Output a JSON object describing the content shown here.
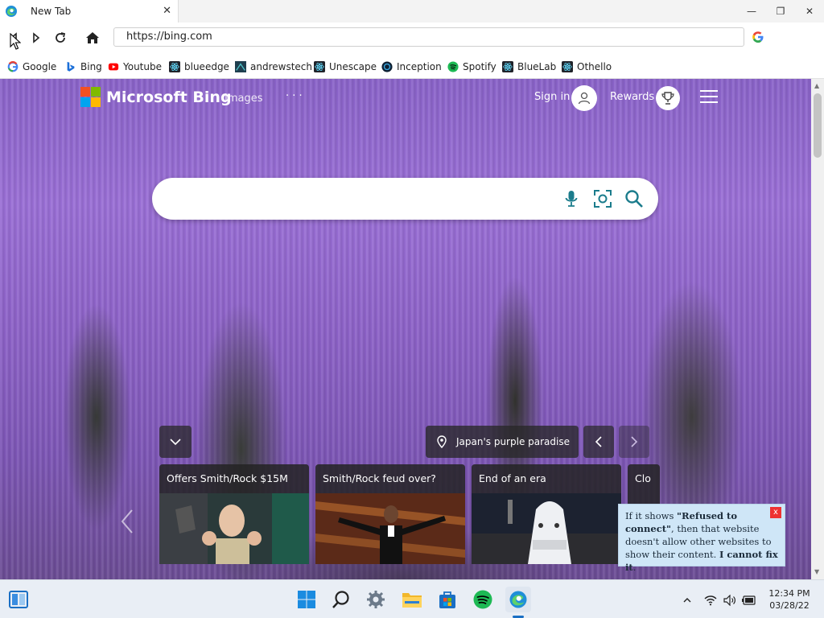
{
  "browser": {
    "tab_title": "New Tab",
    "tab_close": "✕",
    "address": "https://bing.com",
    "controls": {
      "minimize": "—",
      "maximize": "❐",
      "close": "✕"
    }
  },
  "bookmarks": [
    {
      "label": "Google",
      "icon": "google-icon"
    },
    {
      "label": "Bing",
      "icon": "bing-icon"
    },
    {
      "label": "Youtube",
      "icon": "youtube-icon"
    },
    {
      "label": "blueedge",
      "icon": "react-icon"
    },
    {
      "label": "andrewstech",
      "icon": "andrewstech-icon"
    },
    {
      "label": "Unescape",
      "icon": "react-icon"
    },
    {
      "label": "Inception",
      "icon": "inception-icon"
    },
    {
      "label": "Spotify",
      "icon": "spotify-icon"
    },
    {
      "label": "BlueLab",
      "icon": "react-icon"
    },
    {
      "label": "Othello",
      "icon": "react-icon"
    }
  ],
  "bing": {
    "brand": "Microsoft Bing",
    "images_link": "Images",
    "more": "· · ·",
    "sign_in": "Sign in",
    "rewards": "Rewards",
    "location_text": "Japan's purple paradise",
    "news": [
      {
        "title": "Offers Smith/Rock $15M"
      },
      {
        "title": "Smith/Rock feud over?"
      },
      {
        "title": "End of an era"
      },
      {
        "title": "Clo"
      }
    ]
  },
  "tooltip": {
    "line1": "If it shows ",
    "bold1": "\"Refused to connect\"",
    "line2": ", then that website doesn't allow other websites to show their content. ",
    "bold2": "I cannot fix it",
    "end": ".",
    "close": "x"
  },
  "taskbar": {
    "time": "12:34 PM",
    "date": "03/28/22"
  },
  "colors": {
    "bing_teal": "#1b7c8c",
    "ms_red": "#f25022",
    "ms_green": "#7fba00",
    "ms_blue": "#00a4ef",
    "ms_yellow": "#ffb900"
  }
}
